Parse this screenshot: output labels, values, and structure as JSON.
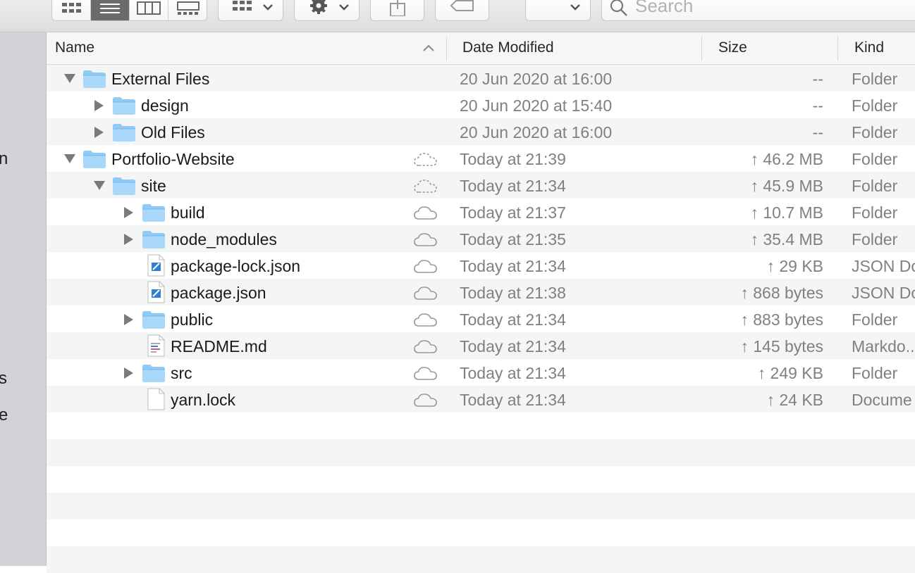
{
  "toolbar": {
    "search_placeholder": "Search",
    "view_modes": [
      "icon-view",
      "list-view",
      "column-view",
      "gallery-view"
    ],
    "active_view": "list-view"
  },
  "sidebar": {
    "partial_labels": [
      "n",
      "s",
      "e"
    ]
  },
  "columns": {
    "name": "Name",
    "date": "Date Modified",
    "size": "Size",
    "kind": "Kind"
  },
  "rows": [
    {
      "name": "External Files",
      "date": "20 Jun 2020 at 16:00",
      "size": "--",
      "kind": "Folder",
      "level": 0,
      "type": "folder",
      "expanded": true,
      "cloud": "none"
    },
    {
      "name": "design",
      "date": "20 Jun 2020 at 15:40",
      "size": "--",
      "kind": "Folder",
      "level": 1,
      "type": "folder",
      "expanded": false,
      "cloud": "none"
    },
    {
      "name": "Old Files",
      "date": "20 Jun 2020 at 16:00",
      "size": "--",
      "kind": "Folder",
      "level": 1,
      "type": "folder",
      "expanded": false,
      "cloud": "none"
    },
    {
      "name": "Portfolio-Website",
      "date": "Today at 21:39",
      "size": "↑ 46.2 MB",
      "kind": "Folder",
      "level": 0,
      "type": "folder",
      "expanded": true,
      "cloud": "dashed"
    },
    {
      "name": "site",
      "date": "Today at 21:34",
      "size": "↑ 45.9 MB",
      "kind": "Folder",
      "level": 1,
      "type": "folder",
      "expanded": true,
      "cloud": "dashed"
    },
    {
      "name": "build",
      "date": "Today at 21:37",
      "size": "↑ 10.7 MB",
      "kind": "Folder",
      "level": 2,
      "type": "folder",
      "expanded": false,
      "cloud": "solid"
    },
    {
      "name": "node_modules",
      "date": "Today at 21:35",
      "size": "↑ 35.4 MB",
      "kind": "Folder",
      "level": 2,
      "type": "folder",
      "expanded": false,
      "cloud": "solid"
    },
    {
      "name": "package-lock.json",
      "date": "Today at 21:34",
      "size": "↑ 29 KB",
      "kind": "JSON Do",
      "level": 2,
      "type": "json",
      "cloud": "solid"
    },
    {
      "name": "package.json",
      "date": "Today at 21:38",
      "size": "↑ 868 bytes",
      "kind": "JSON Do",
      "level": 2,
      "type": "json",
      "cloud": "solid"
    },
    {
      "name": "public",
      "date": "Today at 21:34",
      "size": "↑ 883 bytes",
      "kind": "Folder",
      "level": 2,
      "type": "folder",
      "expanded": false,
      "cloud": "solid"
    },
    {
      "name": "README.md",
      "date": "Today at 21:34",
      "size": "↑ 145 bytes",
      "kind": "Markdo...",
      "level": 2,
      "type": "markdown",
      "cloud": "solid"
    },
    {
      "name": "src",
      "date": "Today at 21:34",
      "size": "↑ 249 KB",
      "kind": "Folder",
      "level": 2,
      "type": "folder",
      "expanded": false,
      "cloud": "solid"
    },
    {
      "name": "yarn.lock",
      "date": "Today at 21:34",
      "size": "↑ 24 KB",
      "kind": "Docume",
      "level": 2,
      "type": "document",
      "cloud": "solid"
    }
  ]
}
